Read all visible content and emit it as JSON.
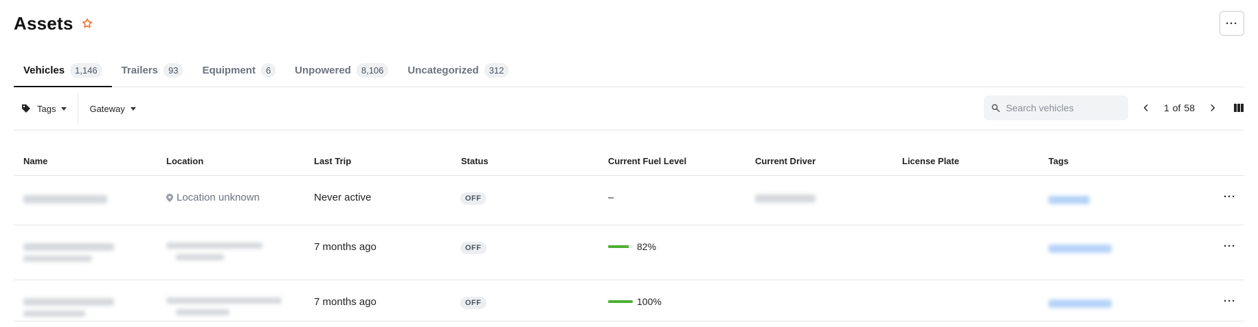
{
  "page": {
    "title": "Assets",
    "more_label": "···"
  },
  "tabs": [
    {
      "label": "Vehicles",
      "count": "1,146"
    },
    {
      "label": "Trailers",
      "count": "93"
    },
    {
      "label": "Equipment",
      "count": "6"
    },
    {
      "label": "Unpowered",
      "count": "8,106"
    },
    {
      "label": "Uncategorized",
      "count": "312"
    }
  ],
  "filters": {
    "tags_label": "Tags",
    "gateway_label": "Gateway"
  },
  "search": {
    "placeholder": "Search vehicles",
    "value": ""
  },
  "pagination": {
    "current": "1",
    "of_label": "of",
    "total": "58"
  },
  "columns": [
    "Name",
    "Location",
    "Last Trip",
    "Status",
    "Current Fuel Level",
    "Current Driver",
    "License Plate",
    "Tags"
  ],
  "rows": [
    {
      "location": "Location unknown",
      "last_trip": "Never active",
      "status": "OFF",
      "fuel_text": "–",
      "fuel_level": null
    },
    {
      "location": "",
      "last_trip": "7 months ago",
      "status": "OFF",
      "fuel_text": "82%",
      "fuel_level": 0.82
    },
    {
      "location": "",
      "last_trip": "7 months ago",
      "status": "OFF",
      "fuel_text": "100%",
      "fuel_level": 1.0
    }
  ],
  "row_more_label": "···",
  "colors": {
    "accent": "#f26b21",
    "fuel_green": "#4caf32",
    "tag_blue": "#9cc3f5"
  },
  "icons": {
    "star": "star-outline-icon",
    "tag": "tag-icon",
    "search": "search-icon",
    "prev": "chevron-left-icon",
    "next": "chevron-right-icon",
    "columns": "columns-icon",
    "pin": "location-pin-icon"
  }
}
